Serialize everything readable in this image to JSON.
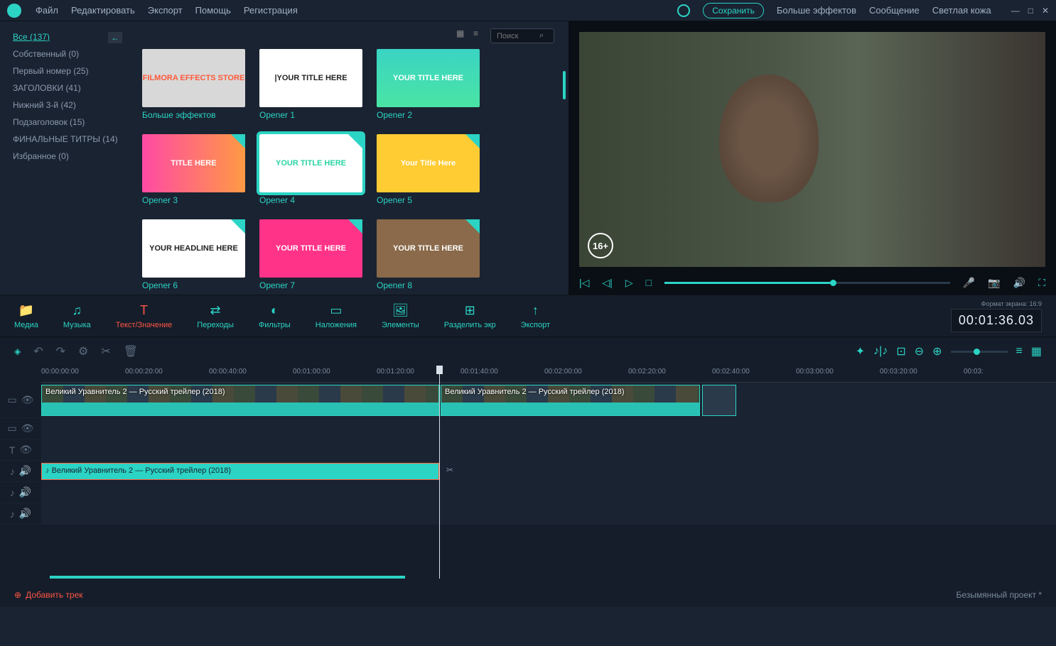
{
  "menu": {
    "file": "Файл",
    "edit": "Редактировать",
    "export": "Экспорт",
    "help": "Помощь",
    "register": "Регистрация"
  },
  "right_menu": {
    "save": "Сохранить",
    "more_fx": "Больше эффектов",
    "message": "Сообщение",
    "light_skin": "Светлая кожа"
  },
  "sidebar": {
    "items": [
      {
        "label": "Все (137)",
        "active": true
      },
      {
        "label": "Собственный (0)"
      },
      {
        "label": "Первый номер (25)"
      },
      {
        "label": "ЗАГОЛОВКИ (41)"
      },
      {
        "label": "Нижний 3-й (42)"
      },
      {
        "label": "Подзаголовок (15)"
      },
      {
        "label": "ФИНАЛЬНЫЕ ТИТРЫ (14)"
      },
      {
        "label": "Избранное (0)"
      }
    ]
  },
  "search": {
    "placeholder": "Поиск"
  },
  "thumbs": [
    {
      "label": "Больше эффектов",
      "bg": "#d8d8d8",
      "txt": "FILMORA EFFECTS STORE",
      "dl": false,
      "color": "#ff5a3a"
    },
    {
      "label": "Opener 1",
      "bg": "#ffffff",
      "txt": "|YOUR TITLE HERE",
      "dl": false,
      "color": "#222"
    },
    {
      "label": "Opener 2",
      "bg": "linear-gradient(#3ad4c4,#4ae4a4)",
      "txt": "YOUR TITLE HERE",
      "dl": false,
      "color": "#fff"
    },
    {
      "label": "Opener 3",
      "bg": "linear-gradient(90deg,#ff4aa4,#ff9a44)",
      "txt": "TITLE HERE",
      "dl": true,
      "color": "#fff"
    },
    {
      "label": "Opener 4",
      "bg": "#ffffff",
      "txt": "YOUR TITLE HERE",
      "dl": true,
      "color": "#2bd4a4",
      "border": "4px solid #2bd4c4"
    },
    {
      "label": "Opener 5",
      "bg": "#ffcc33",
      "txt": "Your Title Here",
      "dl": true,
      "color": "#fff"
    },
    {
      "label": "Opener 6",
      "bg": "#ffffff",
      "txt": "YOUR HEADLINE HERE",
      "dl": true,
      "color": "#222"
    },
    {
      "label": "Opener 7",
      "bg": "#ff3388",
      "txt": "YOUR TITLE HERE",
      "dl": true,
      "color": "#fff"
    },
    {
      "label": "Opener 8",
      "bg": "#8a6a4a",
      "txt": "YOUR TITLE HERE",
      "dl": true,
      "color": "#fff"
    }
  ],
  "preview": {
    "age_rating": "16+"
  },
  "tabs": [
    {
      "label": "Медиа",
      "icon": "📁"
    },
    {
      "label": "Музыка",
      "icon": "♫"
    },
    {
      "label": "Текст/Значение",
      "icon": "T",
      "active": true
    },
    {
      "label": "Переходы",
      "icon": "⇄"
    },
    {
      "label": "Фильтры",
      "icon": "◐"
    },
    {
      "label": "Наложения",
      "icon": "▭"
    },
    {
      "label": "Элементы",
      "icon": "🖼"
    },
    {
      "label": "Разделить экр",
      "icon": "⊞"
    },
    {
      "label": "Экспорт",
      "icon": "↑"
    }
  ],
  "format_label": "Формат экрана: 16:9",
  "timecode": "00:01:36.03",
  "ruler": [
    "00:00:00:00",
    "00:00:20:00",
    "00:00:40:00",
    "00:01:00:00",
    "00:01:20:00",
    "00:01:40:00",
    "00:02:00:00",
    "00:02:20:00",
    "00:02:40:00",
    "00:03:00:00",
    "00:03:20:00",
    "00:03:"
  ],
  "clips": {
    "v1a": "Великий Уравнитель 2 — Русский трейлер (2018)",
    "v1b": "Великий Уравнитель 2 — Русский трейлер (2018)",
    "a1": "Великий Уравнитель 2 — Русский трейлер (2018)"
  },
  "footer": {
    "add_track": "Добавить трек",
    "project": "Безымянный проект *"
  }
}
